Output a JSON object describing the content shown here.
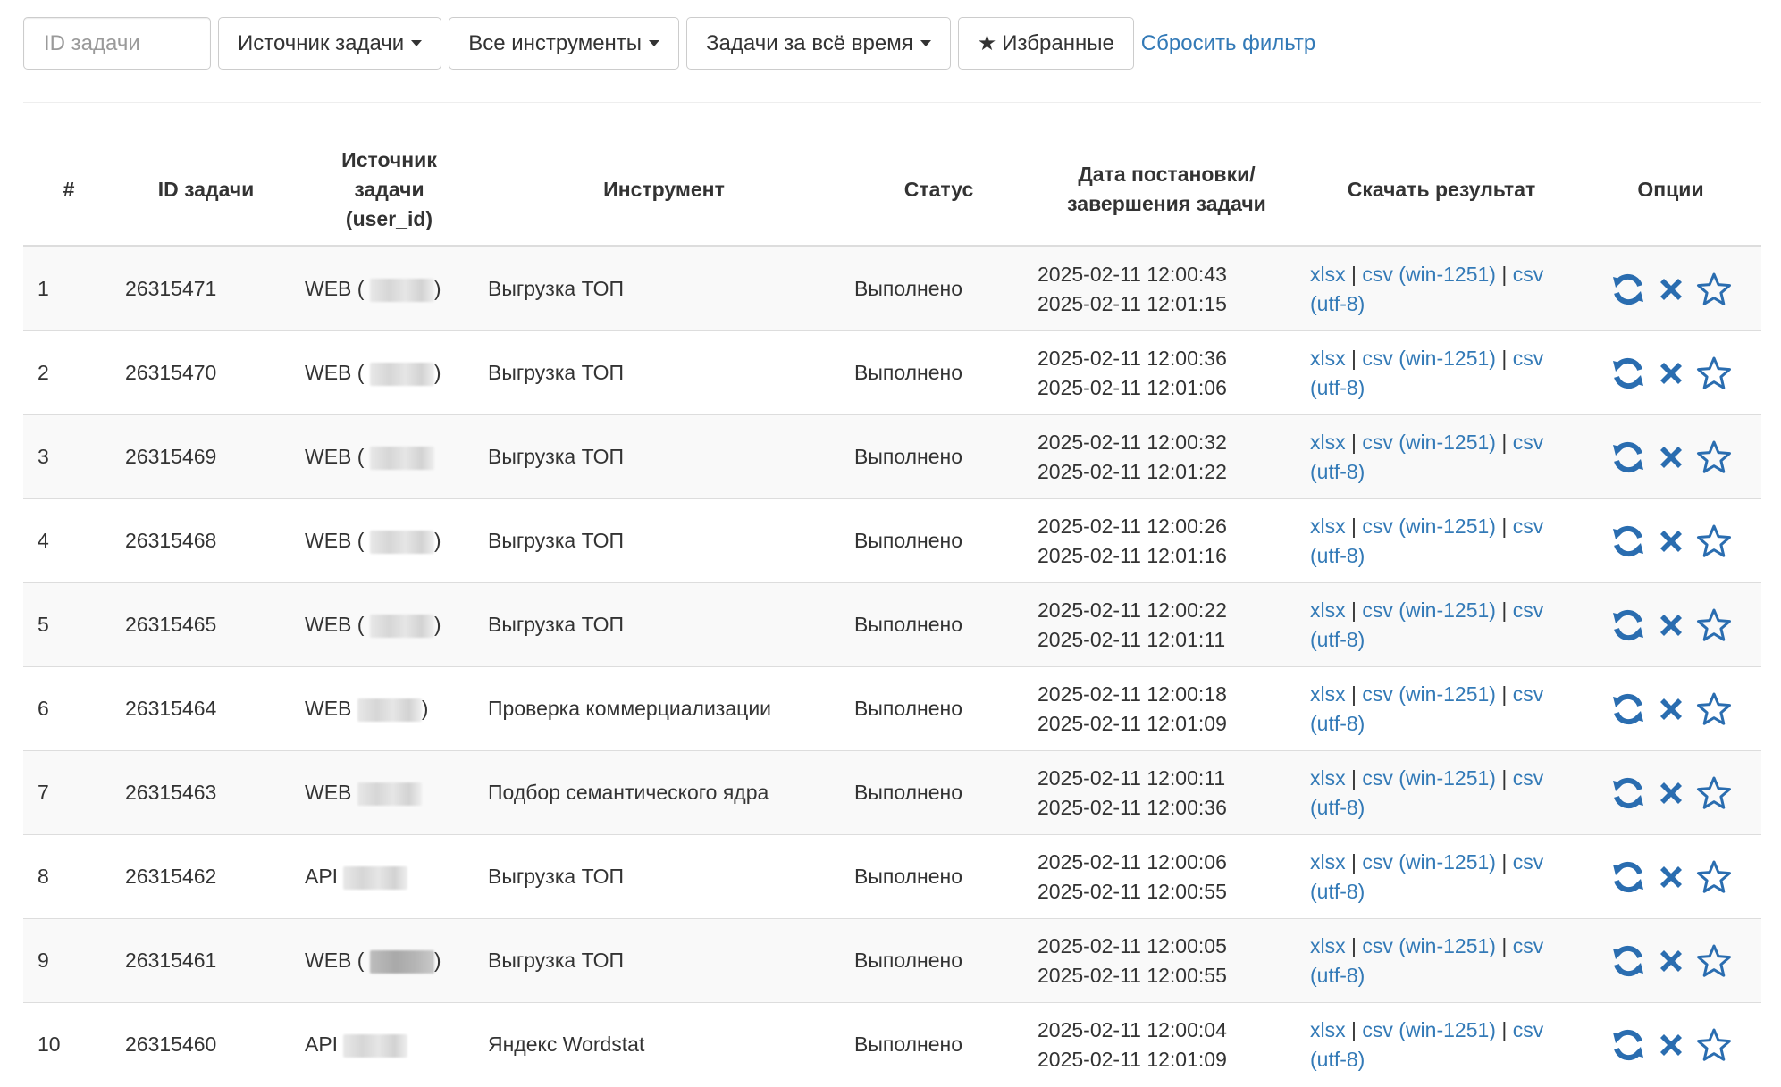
{
  "filters": {
    "search_placeholder": "ID задачи",
    "source_label": "Источник задачи",
    "tools_label": "Все инструменты",
    "period_label": "Задачи за всё время",
    "favorites_label": "Избранные",
    "reset_label": "Сбросить фильтр"
  },
  "table": {
    "headers": {
      "num": "#",
      "id": "ID задачи",
      "source_line1": "Источник",
      "source_line2": "задачи",
      "source_line3": "(user_id)",
      "tool": "Инструмент",
      "status": "Статус",
      "date_line1": "Дата постановки/",
      "date_line2": "завершения задачи",
      "download": "Скачать результат",
      "options": "Опции"
    },
    "download_links": {
      "xlsx": "xlsx",
      "csv_win": "csv (win-1251)",
      "csv_utf": "csv",
      "csv_utf_enc": "(utf-8)",
      "sep": "|"
    },
    "rows": [
      {
        "num": "1",
        "id": "26315471",
        "source": "WEB (",
        "source_tail": ")",
        "tool": "Выгрузка ТОП",
        "status": "Выполнено",
        "start": "2025-02-11 12:00:43",
        "end": "2025-02-11 12:01:15"
      },
      {
        "num": "2",
        "id": "26315470",
        "source": "WEB (",
        "source_tail": ")",
        "tool": "Выгрузка ТОП",
        "status": "Выполнено",
        "start": "2025-02-11 12:00:36",
        "end": "2025-02-11 12:01:06"
      },
      {
        "num": "3",
        "id": "26315469",
        "source": "WEB (",
        "source_tail": "",
        "tool": "Выгрузка ТОП",
        "status": "Выполнено",
        "start": "2025-02-11 12:00:32",
        "end": "2025-02-11 12:01:22"
      },
      {
        "num": "4",
        "id": "26315468",
        "source": "WEB (",
        "source_tail": ")",
        "tool": "Выгрузка ТОП",
        "status": "Выполнено",
        "start": "2025-02-11 12:00:26",
        "end": "2025-02-11 12:01:16"
      },
      {
        "num": "5",
        "id": "26315465",
        "source": "WEB (",
        "source_tail": ")",
        "tool": "Выгрузка ТОП",
        "status": "Выполнено",
        "start": "2025-02-11 12:00:22",
        "end": "2025-02-11 12:01:11"
      },
      {
        "num": "6",
        "id": "26315464",
        "source": "WEB",
        "source_tail": ")",
        "tool": "Проверка коммерциализации",
        "status": "Выполнено",
        "start": "2025-02-11 12:00:18",
        "end": "2025-02-11 12:01:09"
      },
      {
        "num": "7",
        "id": "26315463",
        "source": "WEB",
        "source_tail": "",
        "tool": "Подбор семантического ядра",
        "status": "Выполнено",
        "start": "2025-02-11 12:00:11",
        "end": "2025-02-11 12:00:36"
      },
      {
        "num": "8",
        "id": "26315462",
        "source": "API",
        "source_tail": "",
        "tool": "Выгрузка ТОП",
        "status": "Выполнено",
        "start": "2025-02-11 12:00:06",
        "end": "2025-02-11 12:00:55"
      },
      {
        "num": "9",
        "id": "26315461",
        "source": "WEB (",
        "source_tail": ")",
        "tool": "Выгрузка ТОП",
        "status": "Выполнено",
        "start": "2025-02-11 12:00:05",
        "end": "2025-02-11 12:00:55"
      },
      {
        "num": "10",
        "id": "26315460",
        "source": "API",
        "source_tail": "",
        "tool": "Яндекс Wordstat",
        "status": "Выполнено",
        "start": "2025-02-11 12:00:04",
        "end": "2025-02-11 12:01:09"
      }
    ]
  },
  "icons": {
    "refresh": "refresh-icon",
    "delete": "close-icon",
    "favorite": "star-outline-icon",
    "favorites_button": "star-solid-icon"
  },
  "colors": {
    "link": "#337ab7",
    "icon": "#2a6db0",
    "stripe": "#f9f9f9",
    "border": "#dddddd"
  }
}
